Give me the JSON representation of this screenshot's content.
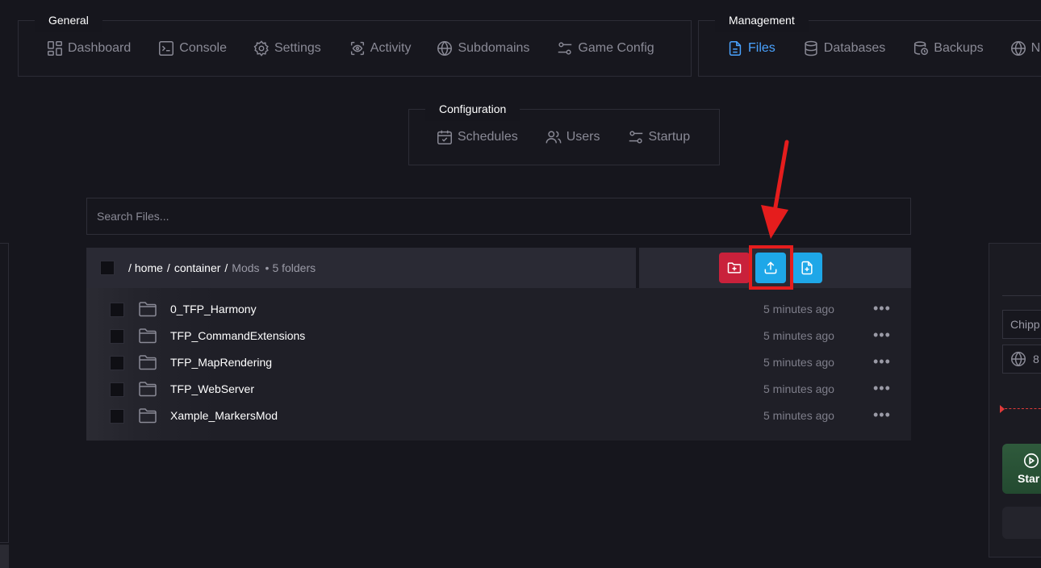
{
  "nav": {
    "general": {
      "title": "General",
      "items": [
        {
          "label": "Dashboard",
          "icon": "dashboard-icon"
        },
        {
          "label": "Console",
          "icon": "console-icon"
        },
        {
          "label": "Settings",
          "icon": "gear-icon"
        },
        {
          "label": "Activity",
          "icon": "eye-icon"
        },
        {
          "label": "Subdomains",
          "icon": "globe-icon"
        },
        {
          "label": "Game Config",
          "icon": "sliders-icon"
        }
      ]
    },
    "management": {
      "title": "Management",
      "items": [
        {
          "label": "Files",
          "icon": "file-icon",
          "active": true
        },
        {
          "label": "Databases",
          "icon": "database-icon"
        },
        {
          "label": "Backups",
          "icon": "backup-icon"
        },
        {
          "label": "N",
          "icon": "globe-icon"
        }
      ]
    },
    "configuration": {
      "title": "Configuration",
      "items": [
        {
          "label": "Schedules",
          "icon": "calendar-icon"
        },
        {
          "label": "Users",
          "icon": "users-icon"
        },
        {
          "label": "Startup",
          "icon": "sliders-icon"
        }
      ]
    }
  },
  "search": {
    "placeholder": "Search Files..."
  },
  "breadcrumb": {
    "root": "/",
    "parts": [
      "home",
      "container"
    ],
    "separator": "/",
    "current": "Mods",
    "dot": "•",
    "count": "5 folders"
  },
  "actions": {
    "new_folder_color": "#c9213b",
    "upload_color": "#1ea7e8",
    "new_file_color": "#1ea7e8"
  },
  "files": [
    {
      "name": "0_TFP_Harmony",
      "modified": "5 minutes ago",
      "more": "•••"
    },
    {
      "name": "TFP_CommandExtensions",
      "modified": "5 minutes ago",
      "more": "•••"
    },
    {
      "name": "TFP_MapRendering",
      "modified": "5 minutes ago",
      "more": "•••"
    },
    {
      "name": "TFP_WebServer",
      "modified": "5 minutes ago",
      "more": "•••"
    },
    {
      "name": "Xample_MarkersMod",
      "modified": "5 minutes ago",
      "more": "•••"
    }
  ],
  "server": {
    "name_partial": "Chipp",
    "ip_partial": "8",
    "start_label": "Star"
  },
  "colors": {
    "accent": "#4aa3ff",
    "annotation": "#e51d1d",
    "background": "#16161d"
  }
}
